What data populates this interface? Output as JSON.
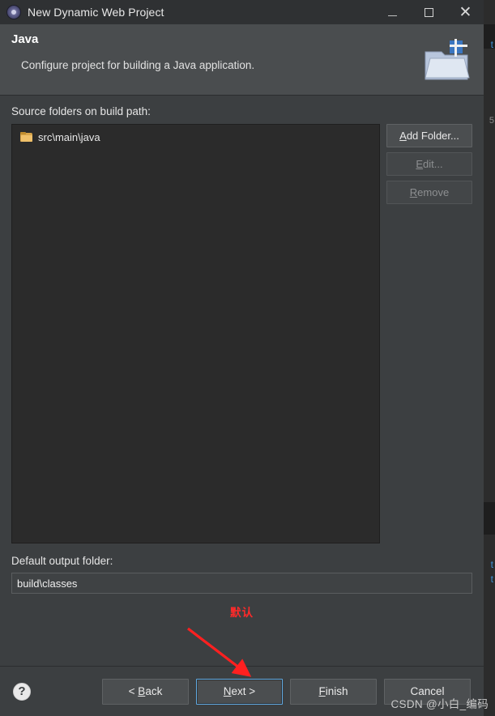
{
  "window": {
    "title": "New Dynamic Web Project",
    "icon": "eclipse-logo-icon",
    "minimize_label": "–",
    "maximize_label": "",
    "close_label": "✕"
  },
  "header": {
    "title": "Java",
    "description": "Configure project for building a Java application.",
    "icon": "java-folder-icon"
  },
  "main": {
    "source_folders_label": "Source folders on build path:",
    "tree_items": [
      {
        "label": "src\\main\\java",
        "icon": "folder-icon"
      }
    ],
    "side_buttons": [
      {
        "label": "Add Folder...",
        "enabled": true,
        "name": "add-folder-button"
      },
      {
        "label": "Edit...",
        "enabled": false,
        "name": "edit-button"
      },
      {
        "label": "Remove",
        "enabled": false,
        "name": "remove-button"
      }
    ],
    "default_output_label": "Default output folder:",
    "default_output_value": "build\\classes",
    "annotation": "默认"
  },
  "footer": {
    "help_label": "?",
    "buttons": [
      {
        "label": "< Back",
        "mnemonic": "B",
        "focused": false,
        "name": "back-button"
      },
      {
        "label": "Next >",
        "mnemonic": "N",
        "focused": true,
        "name": "next-button"
      },
      {
        "label": "Finish",
        "mnemonic": "F",
        "focused": false,
        "name": "finish-button"
      },
      {
        "label": "Cancel",
        "mnemonic": "",
        "focused": false,
        "name": "cancel-button"
      }
    ]
  },
  "background": {
    "line_number": "5",
    "edge_texts": [
      "t",
      "t",
      "t"
    ],
    "accent_color": "#3f8fd0"
  },
  "watermark": "CSDN @小白_编码",
  "colors": {
    "dialog_bg": "#3c3f41",
    "header_bg": "#4a4d4f",
    "titlebar_bg": "#2f3133",
    "tree_bg": "#2b2b2b",
    "accent_focus": "#5fa8e0",
    "annotation_red": "#ff2a2a"
  }
}
